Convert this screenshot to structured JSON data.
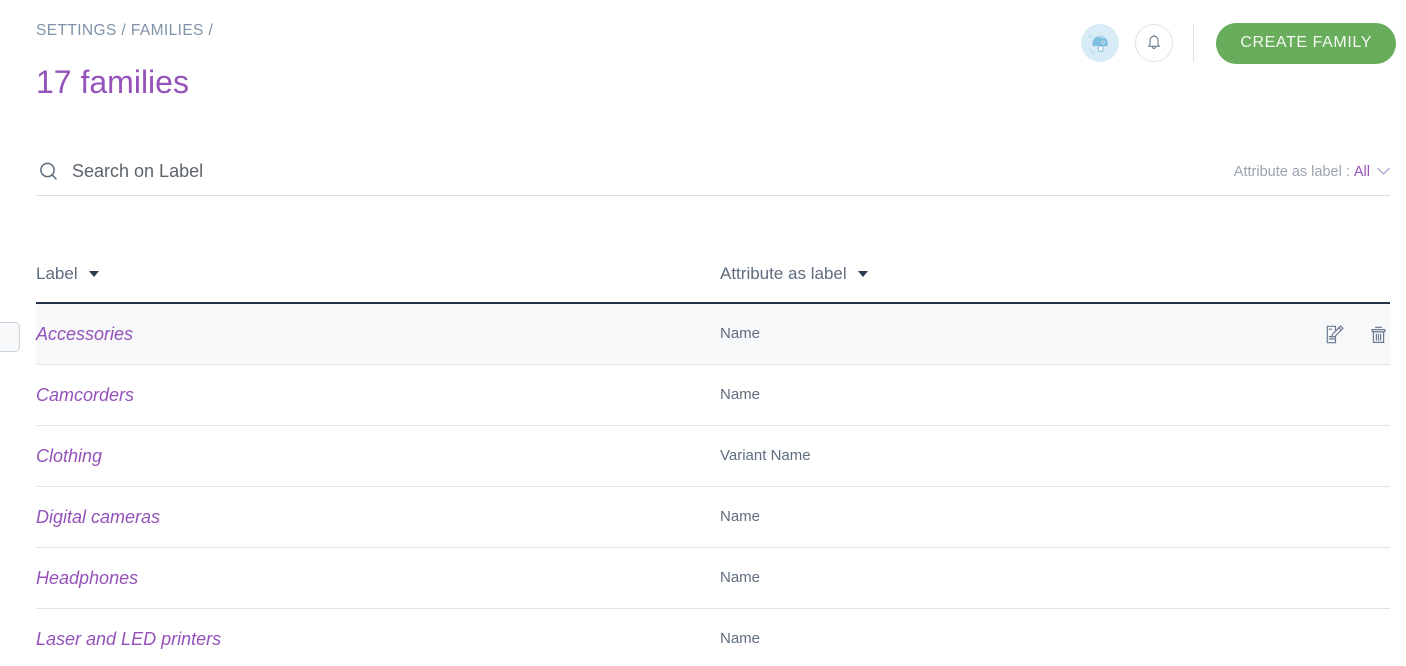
{
  "header": {
    "breadcrumb": "SETTINGS / FAMILIES /",
    "title": "17 families",
    "avatar_icon": "user-avatar-icon",
    "bell_icon": "bell-icon",
    "create_button": "CREATE FAMILY",
    "accent_green": "#67ad5b",
    "accent_purple": "#9452ba"
  },
  "search": {
    "icon": "search-icon",
    "placeholder": "Search on Label",
    "value": "",
    "filter_label": "Attribute as label :",
    "filter_value": "All",
    "filter_chevron_icon": "chevron-down-icon"
  },
  "table": {
    "columns": [
      {
        "key": "label",
        "header": "Label",
        "sort_icon": "caret-down-icon"
      },
      {
        "key": "attribute",
        "header": "Attribute as label",
        "sort_icon": "caret-down-icon"
      }
    ],
    "actions": {
      "edit_icon": "edit-icon",
      "delete_icon": "trash-icon"
    },
    "rows": [
      {
        "label": "Accessories",
        "attribute": "Name",
        "hovered": true
      },
      {
        "label": "Camcorders",
        "attribute": "Name",
        "hovered": false
      },
      {
        "label": "Clothing",
        "attribute": "Variant Name",
        "hovered": false
      },
      {
        "label": "Digital cameras",
        "attribute": "Name",
        "hovered": false
      },
      {
        "label": "Headphones",
        "attribute": "Name",
        "hovered": false
      },
      {
        "label": "Laser and LED printers",
        "attribute": "Name",
        "hovered": false
      }
    ]
  }
}
